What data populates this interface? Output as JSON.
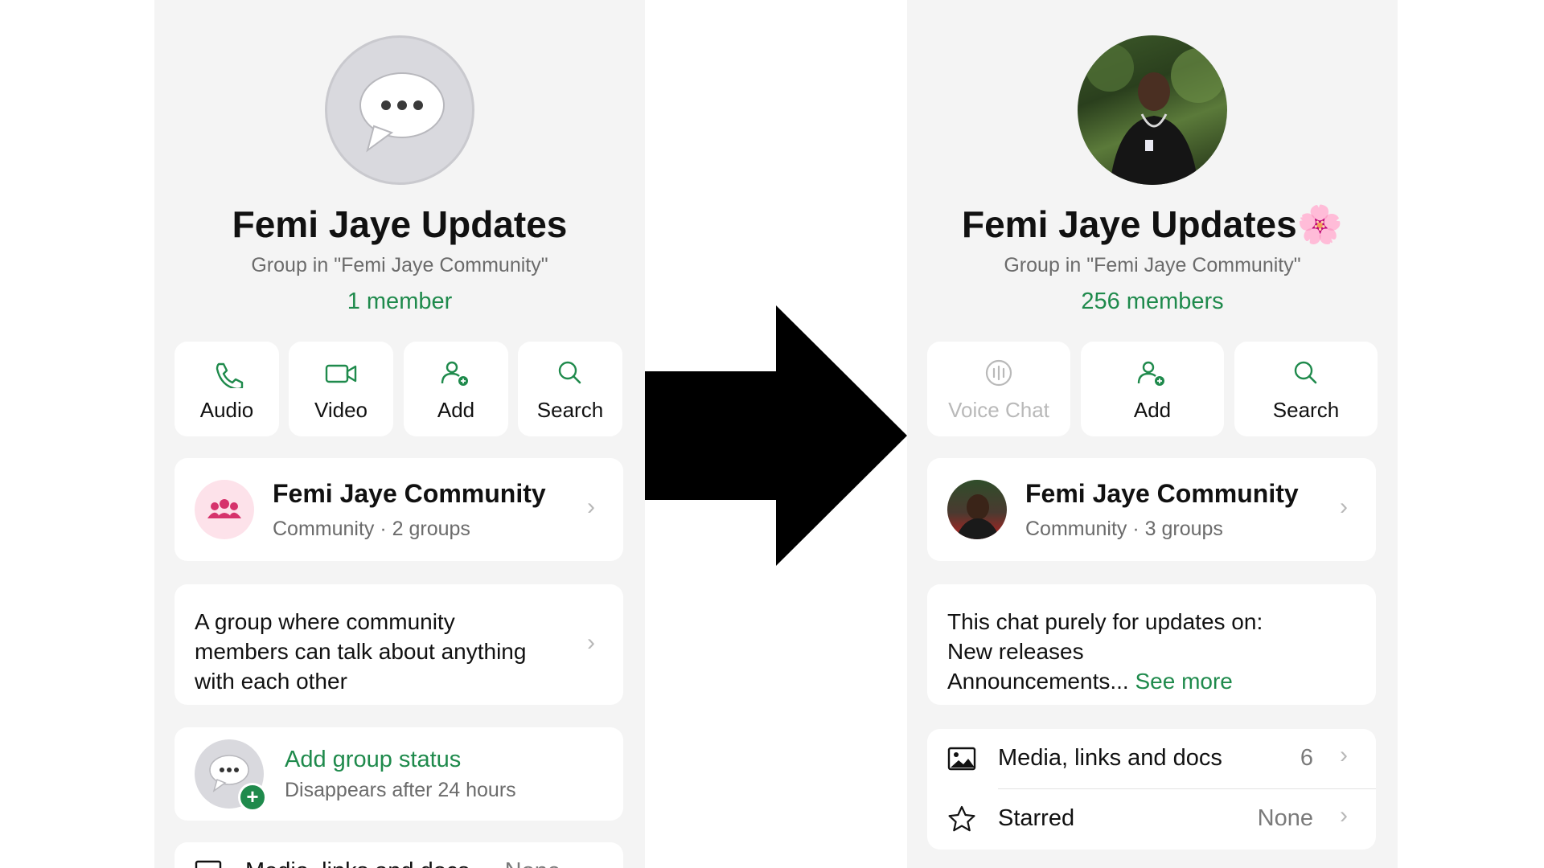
{
  "left": {
    "title": "Femi Jaye Updates",
    "subtitle": "Group in \"Femi Jaye Community\"",
    "members": "1 member",
    "actions": [
      {
        "label": "Audio",
        "icon": "phone-icon"
      },
      {
        "label": "Video",
        "icon": "video-icon"
      },
      {
        "label": "Add",
        "icon": "add-person-icon"
      },
      {
        "label": "Search",
        "icon": "search-icon"
      }
    ],
    "community": {
      "name": "Femi Jaye Community",
      "meta": "Community · 2 groups",
      "icon": "community-icon"
    },
    "description": [
      "A group where community",
      "members can talk about anything",
      "with each other"
    ],
    "status": {
      "title": "Add group status",
      "sub": "Disappears after 24 hours"
    },
    "media": {
      "label": "Media, links and docs",
      "value": "None"
    }
  },
  "right": {
    "title": "Femi Jaye Updates",
    "title_emoji": "🌸",
    "subtitle": "Group in \"Femi Jaye Community\"",
    "members": "256 members",
    "actions": [
      {
        "label": "Voice Chat",
        "icon": "voice-chat-icon",
        "disabled": true
      },
      {
        "label": "Add",
        "icon": "add-person-icon"
      },
      {
        "label": "Search",
        "icon": "search-icon"
      }
    ],
    "community": {
      "name": "Femi Jaye Community",
      "meta": "Community · 3 groups"
    },
    "description": [
      "This chat purely for updates on:",
      "New releases",
      "Announcements..."
    ],
    "see_more": "See more",
    "media": {
      "label": "Media, links and docs",
      "value": "6"
    },
    "starred": {
      "label": "Starred",
      "value": "None"
    }
  },
  "colors": {
    "accent_green": "#1f8a4c",
    "panel_bg": "#f4f4f4",
    "community_pink": "#d6336c"
  }
}
